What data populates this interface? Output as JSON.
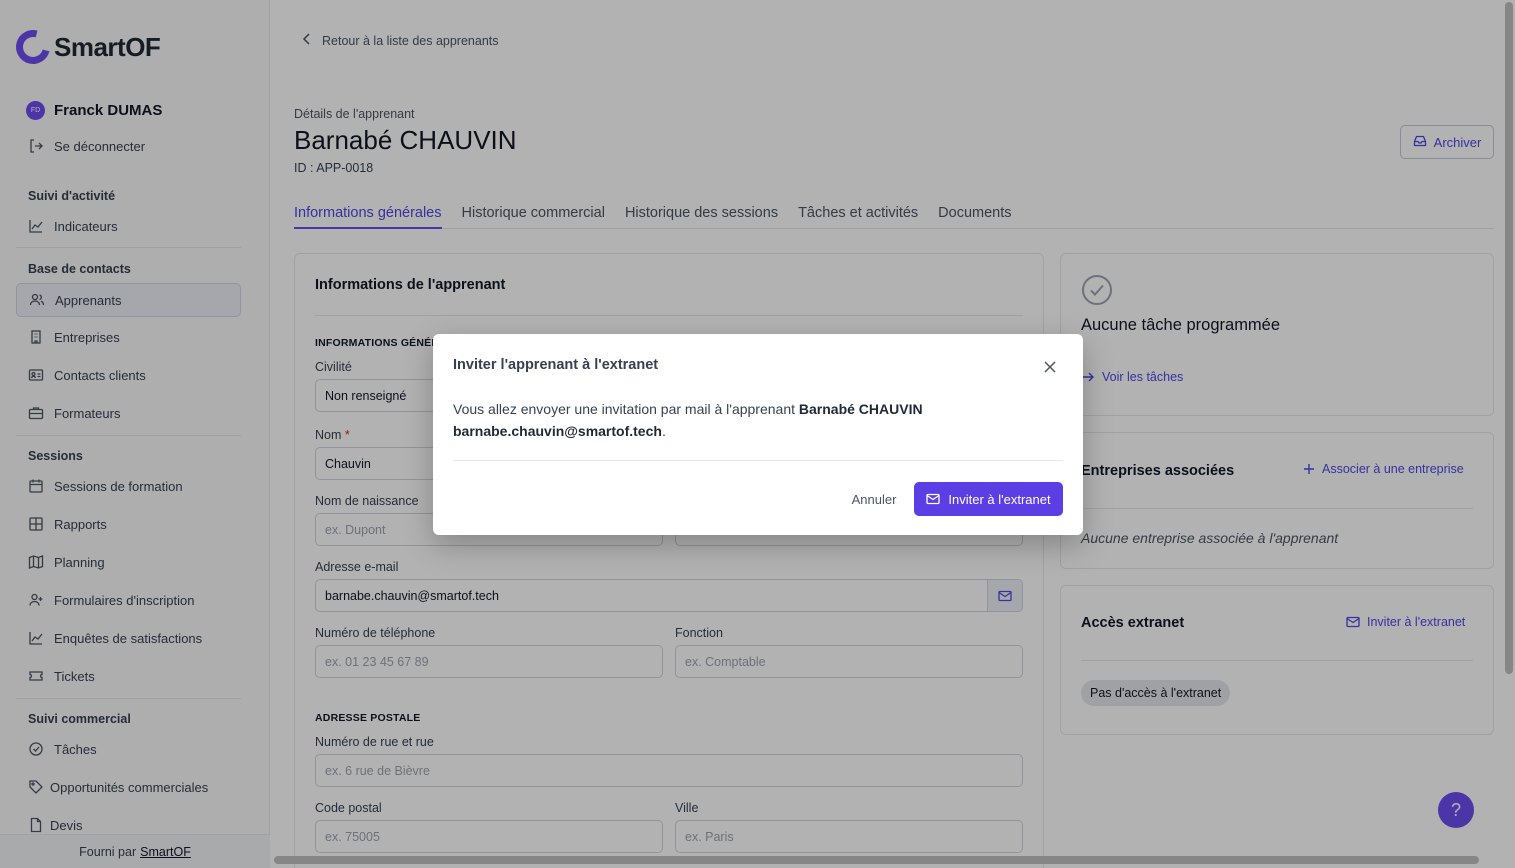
{
  "brand": {
    "name": "SmartOF",
    "accent": "#6d4cf0"
  },
  "user": {
    "initials": "FD",
    "name": "Franck DUMAS",
    "logout": "Se déconnecter"
  },
  "sidebar": {
    "sections": [
      {
        "label": "Suivi d'activité"
      },
      {
        "label": "Base de contacts"
      },
      {
        "label": "Sessions"
      },
      {
        "label": "Suivi commercial"
      }
    ],
    "items": [
      {
        "label": "Indicateurs",
        "icon": "chart-line-icon"
      },
      {
        "label": "Apprenants",
        "icon": "users-icon",
        "active": true
      },
      {
        "label": "Entreprises",
        "icon": "building-icon"
      },
      {
        "label": "Contacts clients",
        "icon": "contact-card-icon"
      },
      {
        "label": "Formateurs",
        "icon": "briefcase-icon"
      },
      {
        "label": "Sessions de formation",
        "icon": "calendar-icon"
      },
      {
        "label": "Rapports",
        "icon": "grid-icon"
      },
      {
        "label": "Planning",
        "icon": "map-icon"
      },
      {
        "label": "Formulaires d'inscription",
        "icon": "user-plus-icon"
      },
      {
        "label": "Enquêtes de satisfactions",
        "icon": "chart-line-icon"
      },
      {
        "label": "Tickets",
        "icon": "ticket-icon"
      },
      {
        "label": "Tâches",
        "icon": "check-circle-icon"
      },
      {
        "label": "Opportunités commerciales",
        "icon": "tag-icon"
      },
      {
        "label": "Devis",
        "icon": "document-icon"
      }
    ],
    "footer_prefix": "Fourni par",
    "footer_link": "SmartOF"
  },
  "page": {
    "back_link": "Retour à la liste des apprenants",
    "subtitle": "Détails de l'apprenant",
    "title": "Barnabé CHAUVIN",
    "id_label": "ID : APP-0018",
    "archive": "Archiver"
  },
  "tabs": [
    {
      "label": "Informations générales",
      "active": true
    },
    {
      "label": "Historique commercial"
    },
    {
      "label": "Historique des sessions"
    },
    {
      "label": "Tâches et activités"
    },
    {
      "label": "Documents"
    }
  ],
  "form": {
    "card_title": "Informations de l'apprenant",
    "section_general": "INFORMATIONS GÉNÉRALES",
    "civilite_label": "Civilité",
    "civilite_value": "Non renseigné",
    "nom_label": "Nom",
    "nom_required": "*",
    "nom_value": "Chauvin",
    "naissance_label": "Nom de naissance",
    "naissance_placeholder": "ex. Dupont",
    "email_label": "Adresse e-mail",
    "email_value": "barnabe.chauvin@smartof.tech",
    "phone_label": "Numéro de téléphone",
    "phone_placeholder": "ex. 01 23 45 67 89",
    "fonction_label": "Fonction",
    "fonction_placeholder": "ex. Comptable",
    "section_address": "ADRESSE POSTALE",
    "street_label": "Numéro de rue et rue",
    "street_placeholder": "ex. 6 rue de Bièvre",
    "zip_label": "Code postal",
    "zip_placeholder": "ex. 75005",
    "city_label": "Ville",
    "city_placeholder": "ex. Paris"
  },
  "tasks_card": {
    "empty": "Aucune tâche programmée",
    "link": "Voir les tâches"
  },
  "companies_card": {
    "title": "Entreprises associées",
    "link": "Associer à une entreprise",
    "empty": "Aucune entreprise associée à l'apprenant"
  },
  "extranet_card": {
    "title": "Accès extranet",
    "link": "Inviter à l'extranet",
    "badge": "Pas d'accès à l'extranet"
  },
  "help": {
    "label": "?"
  },
  "modal": {
    "title": "Inviter l'apprenant à l'extranet",
    "body_prefix": "Vous allez envoyer une invitation par mail à l'apprenant",
    "learner_name": "Barnabé CHAUVIN",
    "learner_email": "barnabe.chauvin@smartof.tech",
    "body_suffix": ".",
    "cancel": "Annuler",
    "confirm": "Inviter à l'extranet"
  }
}
